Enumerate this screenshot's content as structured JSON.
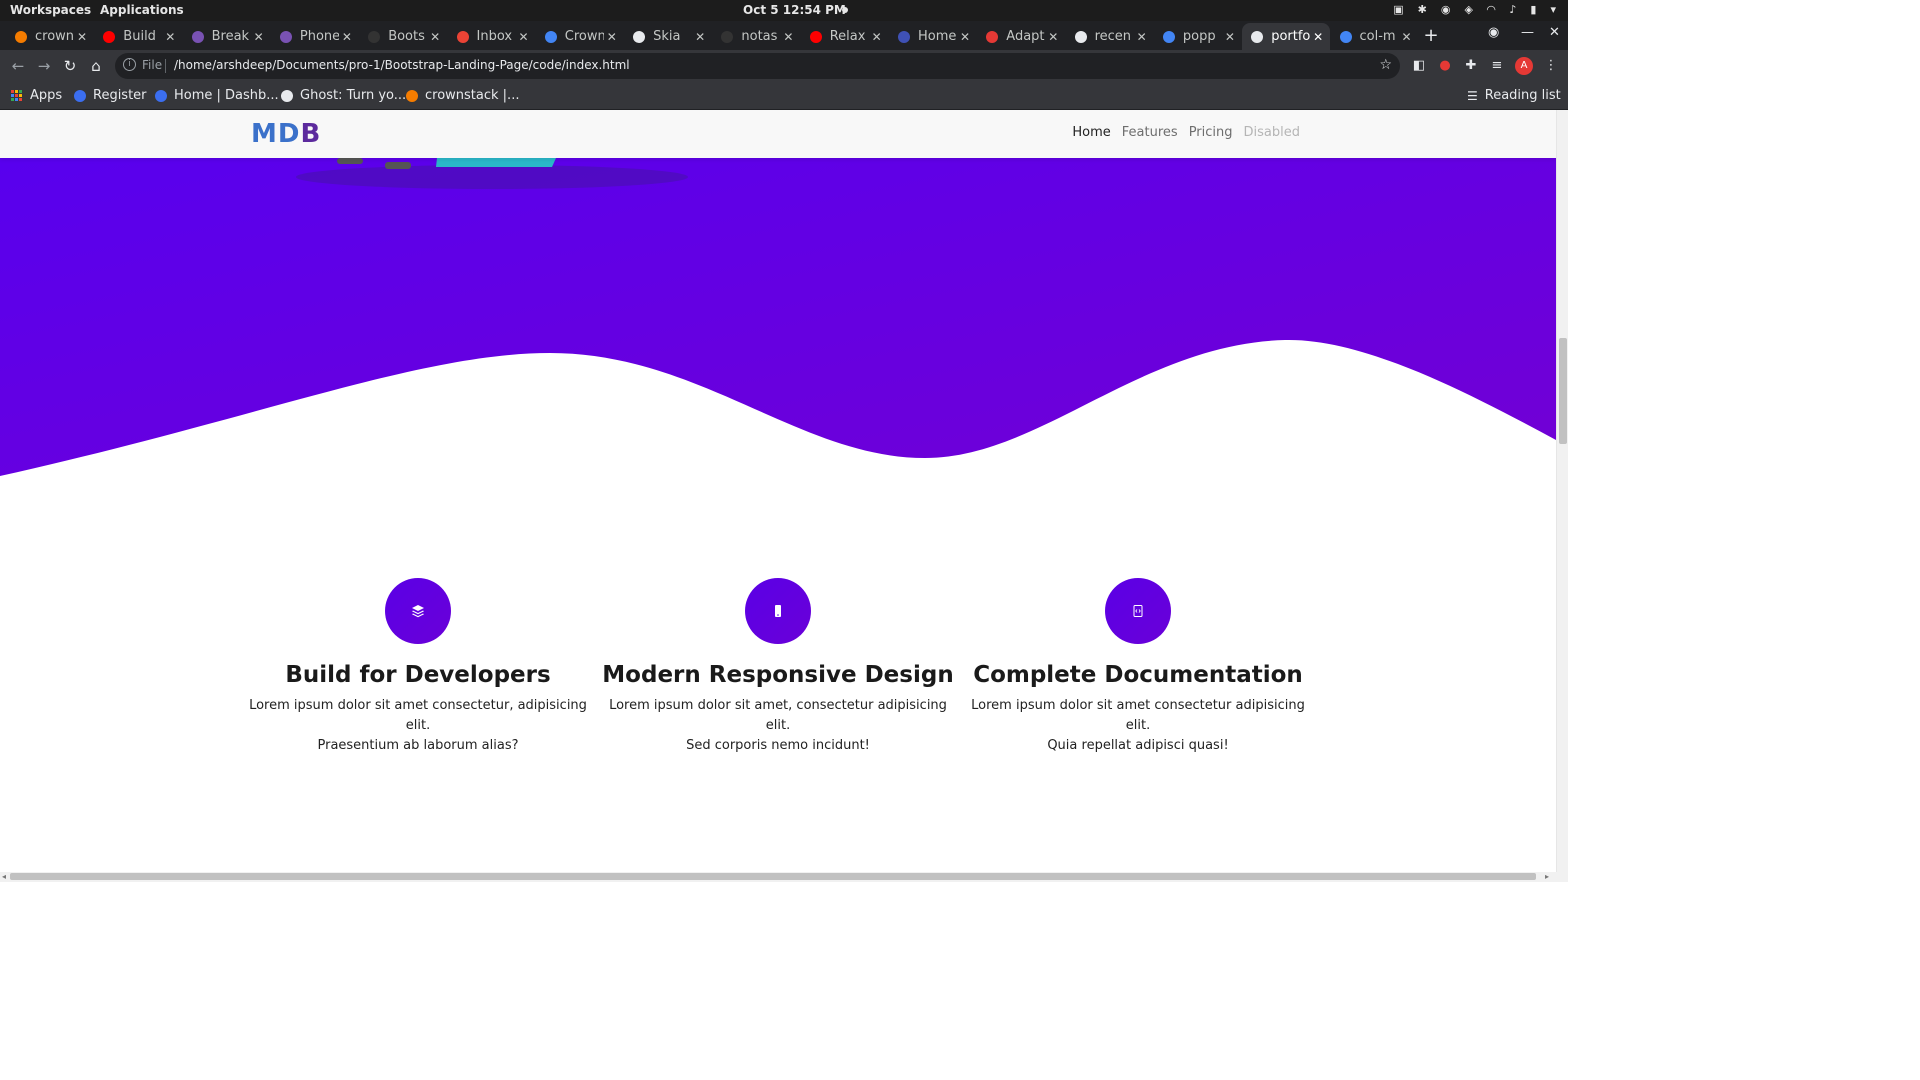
{
  "system": {
    "workspaces": "Workspaces",
    "applications": "Applications",
    "clock": "Oct 5  12:54 PM"
  },
  "tabs": [
    {
      "label": "crown",
      "favicon_color": "#f57c00"
    },
    {
      "label": "Build",
      "favicon_color": "#ff0000"
    },
    {
      "label": "Break",
      "favicon_color": "#7952b3"
    },
    {
      "label": "Phone",
      "favicon_color": "#7952b3"
    },
    {
      "label": "Boots",
      "favicon_color": "#333333"
    },
    {
      "label": "Inbox",
      "favicon_color": "#ea4335"
    },
    {
      "label": "Crown",
      "favicon_color": "#4285f4"
    },
    {
      "label": "Skia",
      "favicon_color": "#e8eaed"
    },
    {
      "label": "notas",
      "favicon_color": "#333333"
    },
    {
      "label": "Relax",
      "favicon_color": "#ff0000"
    },
    {
      "label": "Home",
      "favicon_color": "#3f51b5"
    },
    {
      "label": "Adapt",
      "favicon_color": "#e53935"
    },
    {
      "label": "recen",
      "favicon_color": "#e8eaed"
    },
    {
      "label": "popp",
      "favicon_color": "#4285f4"
    },
    {
      "label": "portfo",
      "favicon_color": "#e8eaed",
      "active": true
    },
    {
      "label": "col-m",
      "favicon_color": "#4285f4"
    }
  ],
  "address_bar": {
    "scheme_label": "File",
    "url": "/home/arshdeep/Documents/pro-1/Bootstrap-Landing-Page/code/index.html"
  },
  "bookmarks": {
    "apps": "Apps",
    "items": [
      {
        "label": "Register",
        "icon_color": "#3b6ef0"
      },
      {
        "label": "Home | Dashb...",
        "icon_color": "#3b6ef0"
      },
      {
        "label": "Ghost: Turn yo...",
        "icon_color": "#e8eaed"
      },
      {
        "label": "crownstack |...",
        "icon_color": "#f57c00"
      }
    ],
    "reading_list": "Reading list"
  },
  "site": {
    "brand_a": "MD",
    "brand_b": "B",
    "nav": {
      "home": "Home",
      "features": "Features",
      "pricing": "Pricing",
      "disabled": "Disabled"
    },
    "hero_color": "#6200ea",
    "features": [
      {
        "icon": "layers-icon",
        "title": "Build for Developers",
        "text_line1": "Lorem ipsum dolor sit amet consectetur, adipisicing elit.",
        "text_line2": "Praesentium ab laborum alias?"
      },
      {
        "icon": "mobile-icon",
        "title": "Modern Responsive Design",
        "text_line1": "Lorem ipsum dolor sit amet, consectetur adipisicing elit.",
        "text_line2": "Sed corporis nemo incidunt!"
      },
      {
        "icon": "code-file-icon",
        "title": "Complete Documentation",
        "text_line1": "Lorem ipsum dolor sit amet consectetur adipisicing elit.",
        "text_line2": "Quia repellat adipisci quasi!"
      }
    ]
  }
}
